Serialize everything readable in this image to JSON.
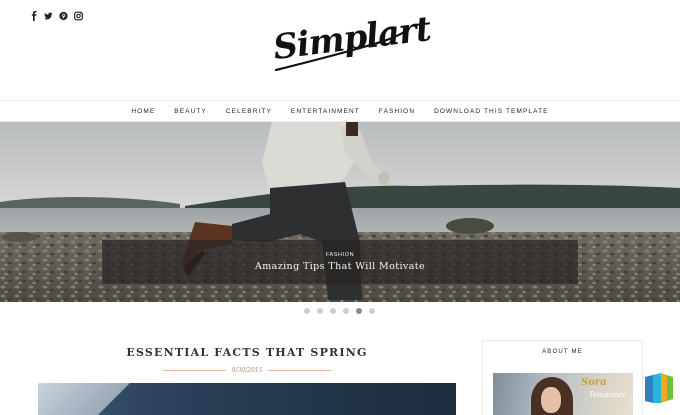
{
  "social": {
    "icons": [
      "facebook-icon",
      "twitter-icon",
      "pinterest-icon",
      "instagram-icon"
    ]
  },
  "logo": {
    "text": "Simplart"
  },
  "nav": {
    "items": [
      "Home",
      "Beauty",
      "Celebrity",
      "Entertainment",
      "Fashion",
      "Download This Template"
    ]
  },
  "slider": {
    "category": "Fashion",
    "title": "Amazing Tips That Will Motivate",
    "slide_count": 6,
    "active_index": 4
  },
  "post": {
    "title": "ESSENTIAL FACTS THAT SPRING",
    "date": "9/30/2015"
  },
  "sidebar": {
    "about_title": "ABOUT ME",
    "image_brand": "Sora",
    "image_brand_sub": "Templates"
  },
  "colors": {
    "accent_line": "#e0b79e",
    "date_text": "#b08a74",
    "caption_bg": "rgba(40,38,36,0.72)"
  }
}
